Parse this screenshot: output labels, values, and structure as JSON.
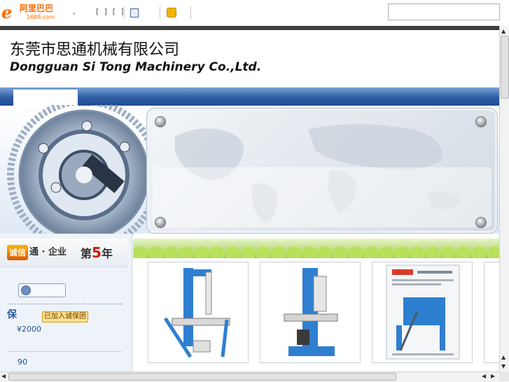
{
  "toolbar": {
    "logo_cn": "阿里巴巴",
    "logo_url": "1688.com",
    "logo_mark": "e",
    "separator_text": ",",
    "brackets_text": "[ ] [ ]",
    "search_value": ""
  },
  "header": {
    "company_cn": "东莞市思通机械有限公司",
    "company_en": "Dongguan Si Tong Machinery Co.,Ltd."
  },
  "sidebar": {
    "chengxintong_badge": "诚信",
    "chengxintong_text": "通 · 企业",
    "years_prefix": "第",
    "years_num": "5",
    "years_suffix": "年",
    "bao_label": "保",
    "joined_badge": "已加入诚保团",
    "amount": "¥2000",
    "count": "90"
  },
  "icons": {
    "scroll_up": "up-arrow-icon",
    "scroll_down": "down-arrow-icon",
    "scroll_left": "left-arrow-icon",
    "scroll_right": "right-arrow-icon"
  },
  "colors": {
    "brand_orange": "#ff6a00",
    "nav_blue": "#2f5ea3",
    "price_blue": "#1d4f9a",
    "year_red": "#cc1a00"
  }
}
